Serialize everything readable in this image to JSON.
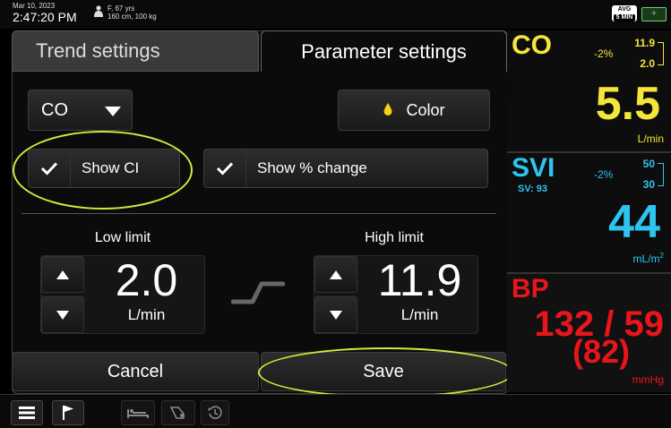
{
  "status": {
    "date": "Mar 10, 2023",
    "time": "2:47:20 PM",
    "patient_line1": "F, 67 yrs",
    "patient_line2": "160 cm, 100 kg",
    "avg_label": "AVG",
    "avg_interval": "5 MIN",
    "battery_symbol": "+"
  },
  "tabs": {
    "trend": "Trend settings",
    "parameter": "Parameter settings",
    "active": "parameter"
  },
  "controls": {
    "parameter_select": "CO",
    "color_label": "Color",
    "show_ci_label": "Show CI",
    "show_ci_checked": true,
    "show_pct_label": "Show % change",
    "show_pct_checked": true
  },
  "limits": {
    "low_label": "Low limit",
    "low_value": "2.0",
    "low_unit": "L/min",
    "high_label": "High limit",
    "high_value": "11.9",
    "high_unit": "L/min"
  },
  "actions": {
    "cancel": "Cancel",
    "save": "Save"
  },
  "parameters": {
    "co": {
      "name": "CO",
      "change": "-2%",
      "high": "11.9",
      "low": "2.0",
      "value": "5.5",
      "unit": "L/min",
      "color": "#f5e63a"
    },
    "svi": {
      "name": "SVI",
      "sub": "SV: 93",
      "change": "-2%",
      "high": "50",
      "low": "30",
      "value": "44",
      "unit": "mL/m",
      "unit_sup": "2",
      "color": "#2ec4f0"
    },
    "bp": {
      "name": "BP",
      "value": "132 / 59",
      "map": "(82)",
      "unit": "mmHg",
      "color": "#e8151b"
    }
  },
  "colors": {
    "highlight": "#c8f03c",
    "co": "#f5e63a",
    "svi": "#2ec4f0",
    "bp": "#e8151b"
  },
  "icons": {
    "menu": "menu-icon",
    "flag": "flag-icon",
    "bed": "patient-bed-icon",
    "monitor": "monitor-icon",
    "history": "history-icon"
  }
}
